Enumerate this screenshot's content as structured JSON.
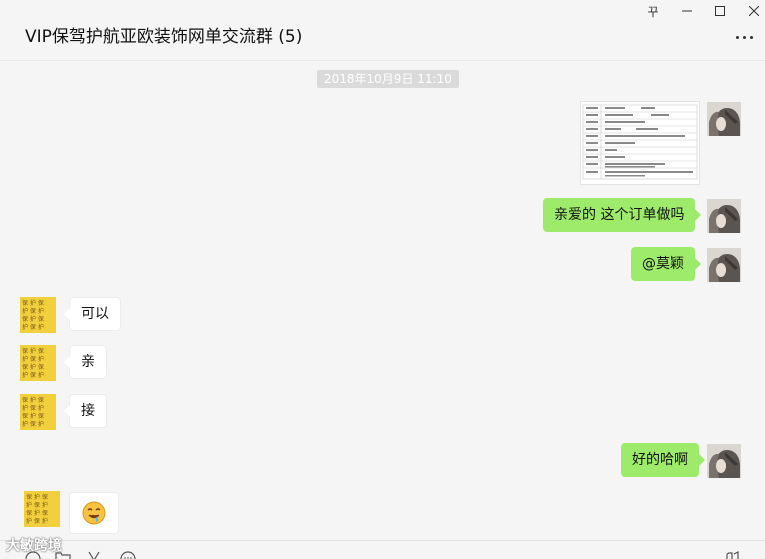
{
  "window": {
    "title": "VIP保驾护航亚欧装饰网单交流群 (5)",
    "controls": {
      "pin": "꾸",
      "minimize": "—",
      "maximize": "☐",
      "close": "✕"
    }
  },
  "chat": {
    "timestamp": "2018年10月9日 11:10",
    "messages": [
      {
        "sender": "me",
        "type": "image",
        "text": ""
      },
      {
        "sender": "me",
        "type": "text",
        "text": "亲爱的  这个订单做吗"
      },
      {
        "sender": "me",
        "type": "text",
        "text": "@莫颖"
      },
      {
        "sender": "other",
        "type": "text",
        "text": "可以"
      },
      {
        "sender": "other",
        "type": "text",
        "text": "亲"
      },
      {
        "sender": "other",
        "type": "text",
        "text": "接"
      },
      {
        "sender": "me",
        "type": "text",
        "text": "好的哈啊"
      },
      {
        "sender": "other",
        "type": "emoji",
        "text": "🤤"
      }
    ]
  },
  "toolbar": {
    "icons": [
      "emoji-icon",
      "folder-icon",
      "scissors-icon",
      "chat-bubble-icon",
      "phone-icon"
    ]
  },
  "watermark": "大敏跨境",
  "colors": {
    "bubble_me": "#9eea6a",
    "bubble_other": "#ffffff",
    "background": "#f5f5f5",
    "timestamp_bg": "#dadada"
  }
}
